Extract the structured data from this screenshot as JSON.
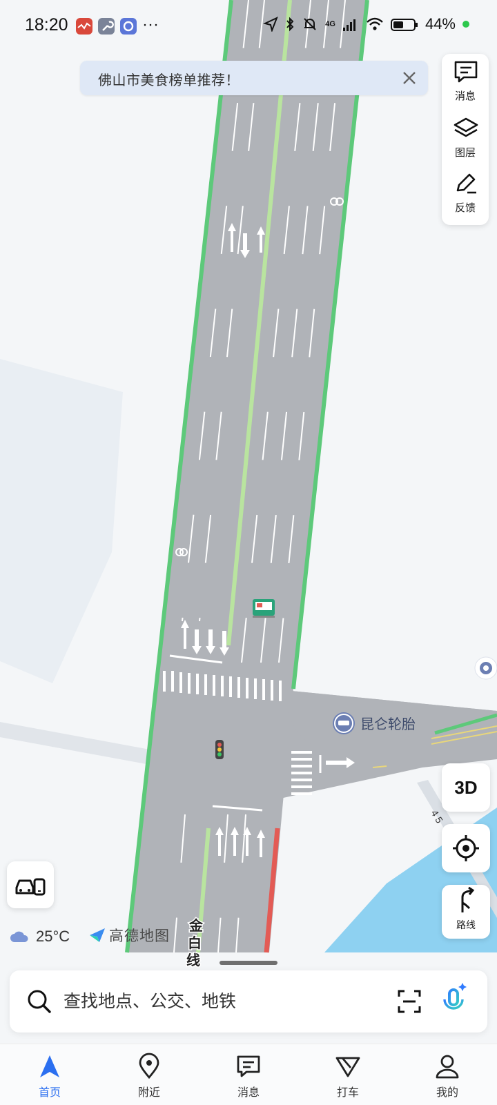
{
  "status_bar": {
    "time": "18:20",
    "network_label": "4G",
    "battery": "44%",
    "icons": [
      "app-red-icon",
      "wrench-app-icon",
      "blue-app-icon",
      "more-dots-icon",
      "location-arrow-icon",
      "bluetooth-icon",
      "muted-bell-icon",
      "signal-icon",
      "wifi-icon",
      "battery-icon"
    ]
  },
  "banner": {
    "text": "佛山市美食榜单推荐！"
  },
  "tools": {
    "messages": "消息",
    "layers": "图层",
    "feedback": "反馈"
  },
  "map": {
    "poi_label": "昆仑轮胎",
    "road_label_chars": [
      "金",
      "白",
      "线"
    ],
    "road_number": "4 5"
  },
  "controls": {
    "three_d": "3D",
    "route": "路线"
  },
  "weather": {
    "temp": "25°C"
  },
  "brand": {
    "name": "高德地图"
  },
  "search": {
    "placeholder": "查找地点、公交、地铁"
  },
  "tabs": [
    {
      "label": "首页",
      "icon": "navigation-arrow-icon",
      "active": true
    },
    {
      "label": "附近",
      "icon": "location-pin-icon",
      "active": false
    },
    {
      "label": "消息",
      "icon": "message-icon",
      "active": false
    },
    {
      "label": "打车",
      "icon": "taxi-icon",
      "active": false
    },
    {
      "label": "我的",
      "icon": "user-icon",
      "active": false
    }
  ],
  "colors": {
    "accent": "#2b6ff0",
    "road": "#b0b3b8",
    "road_edge": "#5dc97a",
    "congestion_red": "#e35b55",
    "water": "#8ed1f1",
    "banner_bg": "#dfe8f6"
  }
}
